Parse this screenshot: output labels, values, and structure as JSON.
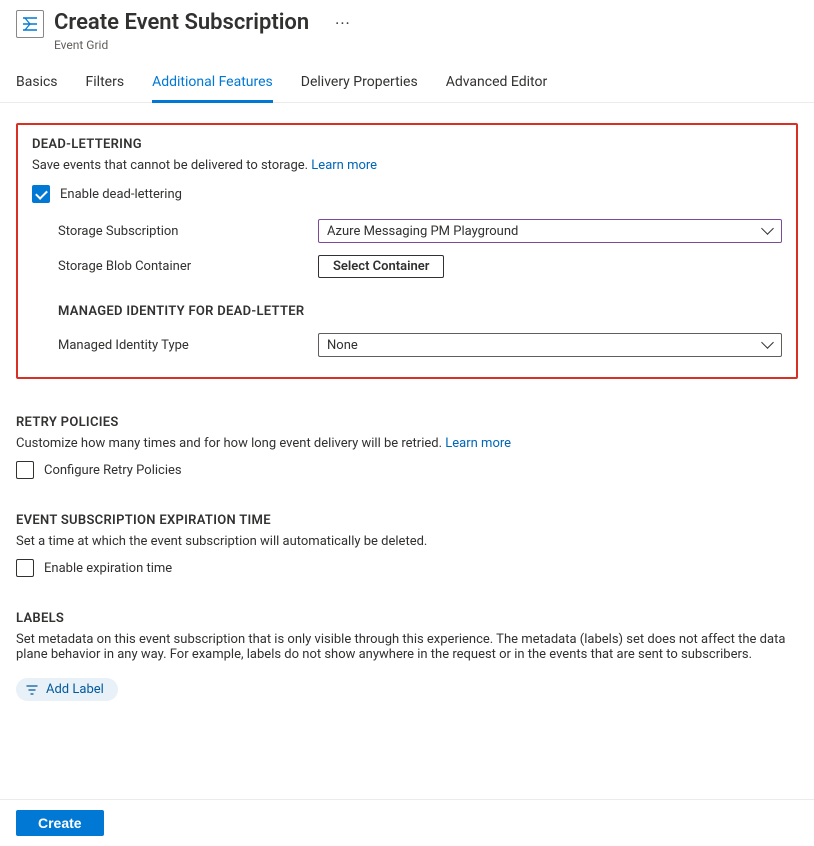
{
  "header": {
    "title": "Create Event Subscription",
    "subtitle": "Event Grid"
  },
  "tabs": [
    {
      "label": "Basics"
    },
    {
      "label": "Filters"
    },
    {
      "label": "Additional Features",
      "active": true
    },
    {
      "label": "Delivery Properties"
    },
    {
      "label": "Advanced Editor"
    }
  ],
  "deadLettering": {
    "heading": "DEAD-LETTERING",
    "desc": "Save events that cannot be delivered to storage. ",
    "learnMore": "Learn more",
    "enableLabel": "Enable dead-lettering",
    "enabled": true,
    "storageSubscriptionLabel": "Storage Subscription",
    "storageSubscriptionValue": "Azure Messaging PM Playground",
    "storageBlobLabel": "Storage Blob Container",
    "selectContainerButton": "Select Container",
    "managedIdentityHeading": "MANAGED IDENTITY FOR DEAD-LETTER",
    "managedIdentityTypeLabel": "Managed Identity Type",
    "managedIdentityTypeValue": "None"
  },
  "retry": {
    "heading": "RETRY POLICIES",
    "desc": "Customize how many times and for how long event delivery will be retried. ",
    "learnMore": "Learn more",
    "configureLabel": "Configure Retry Policies",
    "configureChecked": false
  },
  "expiration": {
    "heading": "EVENT SUBSCRIPTION EXPIRATION TIME",
    "desc": "Set a time at which the event subscription will automatically be deleted.",
    "enableLabel": "Enable expiration time",
    "enableChecked": false
  },
  "labels": {
    "heading": "LABELS",
    "desc": "Set metadata on this event subscription that is only visible through this experience. The metadata (labels) set does not affect the data plane behavior in any way. For example, labels do not show anywhere in the request or in the events that are sent to subscribers.",
    "addLabelButton": "Add Label"
  },
  "footer": {
    "createButton": "Create"
  }
}
